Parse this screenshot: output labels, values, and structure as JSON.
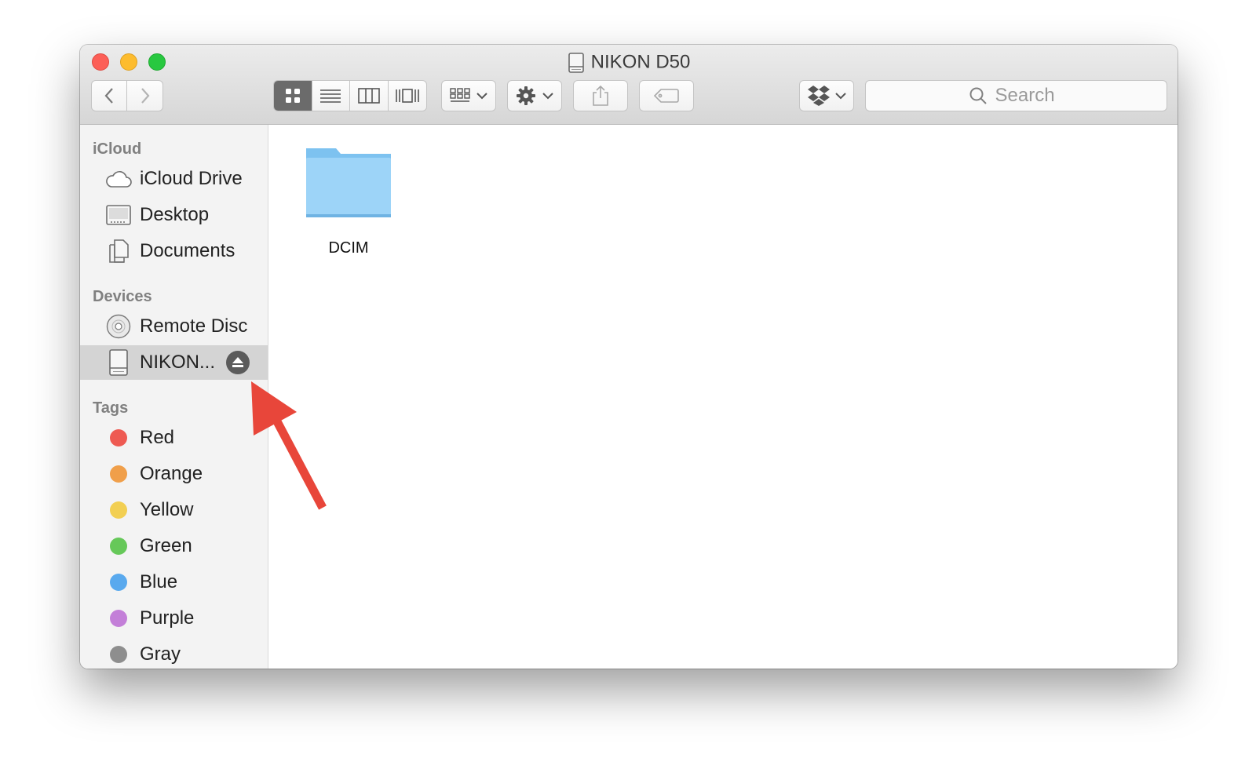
{
  "window": {
    "title": "NIKON D50"
  },
  "toolbar": {
    "back_icon": "chevron-left-icon",
    "forward_icon": "chevron-right-icon",
    "view_modes": [
      "icon-view",
      "list-view",
      "column-view",
      "cover-flow-view"
    ],
    "active_view": "icon-view",
    "arrange_icon": "grid-icon",
    "action_icon": "gear-icon",
    "share_icon": "share-icon",
    "tag_icon": "tag-icon",
    "dropbox_icon": "dropbox-icon",
    "search": {
      "placeholder": "Search"
    }
  },
  "sidebar": {
    "icloud": {
      "heading": "iCloud",
      "items": [
        {
          "label": "iCloud Drive",
          "icon": "cloud-icon"
        },
        {
          "label": "Desktop",
          "icon": "desktop-icon"
        },
        {
          "label": "Documents",
          "icon": "document-icon"
        }
      ]
    },
    "devices": {
      "heading": "Devices",
      "items": [
        {
          "label": "Remote Disc",
          "icon": "disc-icon"
        },
        {
          "label": "NIKON...",
          "icon": "drive-icon",
          "selected": true,
          "eject_icon": "eject-icon"
        }
      ]
    },
    "tags": {
      "heading": "Tags",
      "items": [
        {
          "label": "Red",
          "color": "#ee5a52"
        },
        {
          "label": "Orange",
          "color": "#f09f4a"
        },
        {
          "label": "Yellow",
          "color": "#f2cf52"
        },
        {
          "label": "Green",
          "color": "#66c859"
        },
        {
          "label": "Blue",
          "color": "#59a9ee"
        },
        {
          "label": "Purple",
          "color": "#c37fd8"
        },
        {
          "label": "Gray",
          "color": "#8e8e8e"
        }
      ]
    }
  },
  "content": {
    "items": [
      {
        "name": "DCIM",
        "icon": "folder-icon"
      }
    ]
  },
  "annotation": {
    "color": "#e8463a",
    "points_to": "eject-button"
  }
}
